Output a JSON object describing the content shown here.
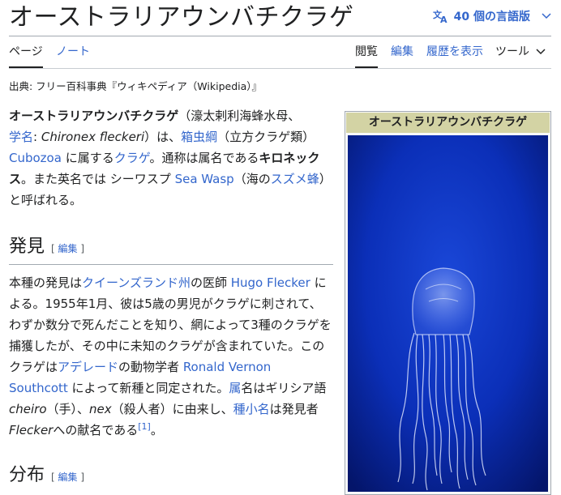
{
  "article": {
    "title": "オーストラリアウンバチクラゲ",
    "language_button": "40 個の言語版"
  },
  "tabs": {
    "page": "ページ",
    "talk": "ノート",
    "read": "閲覧",
    "edit": "編集",
    "history": "履歴を表示",
    "tools": "ツール"
  },
  "source_line": "出典: フリー百科事典『ウィキペディア（Wikipedia）』",
  "lead": {
    "name_bold": "オーストラリアウンバチクラゲ",
    "kanji": "（濠太剌利海蜂水母、",
    "sci_name_link": "学名",
    "colon": ": ",
    "sci_name": "Chironex fleckeri",
    "t1": "）は、",
    "class_link": "箱虫綱",
    "t2": "（立方クラゲ類）",
    "cubozoa_link": "Cubozoa",
    "t3": " に属する",
    "kurage_link": "クラゲ",
    "t4": "。通称は属名である",
    "genus_bold": "キロネックス",
    "t5": "。また英名では シーワスプ ",
    "seawasp_link": "Sea Wasp",
    "t6": "（海の",
    "suzumebachi_link": "スズメ蜂",
    "t7": "）と呼ばれる。"
  },
  "section_discovery": {
    "heading": "発見",
    "edit_label": "編集",
    "p1": "本種の発見は",
    "queensland_link": "クイーンズランド州",
    "p2": "の医師 ",
    "flecker_link": "Hugo Flecker",
    "p3": " による。1955年1月、彼は5歳の男児がクラゲに刺されて、わずか数分で死んだことを知り、網によって3種のクラゲを捕獲したが、その中に未知のクラゲが含まれていた。このクラゲは",
    "adelaide_link": "アデレード",
    "p4": "の動物学者 ",
    "southcott_link": "Ronald Vernon Southcott",
    "p5": " によって新種と同定された。",
    "genus_link": "属",
    "p6": "名はギリシア語 ",
    "cheiro": "cheiro",
    "p7": "（手）、",
    "nex": "nex",
    "p8": "（殺人者）に由来し、",
    "species_link": "種小名",
    "p9": "は発見者",
    "flecker_italic": "Flecker",
    "p10": "への献名である",
    "ref": "[1]",
    "p11": "。"
  },
  "section_distribution": {
    "heading": "分布",
    "edit_label": "編集"
  },
  "infobox": {
    "title": "オーストラリアウンバチクラゲ",
    "image_icon": "box-jellyfish-photo"
  }
}
